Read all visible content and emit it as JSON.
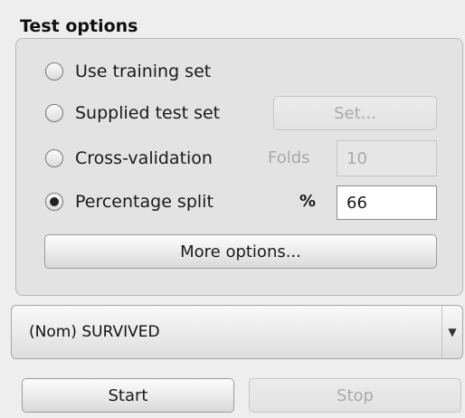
{
  "test_options": {
    "title": "Test options",
    "use_training_set": {
      "label": "Use training set",
      "selected": false
    },
    "supplied_test_set": {
      "label": "Supplied test set",
      "selected": false,
      "set_button": "Set..."
    },
    "cross_validation": {
      "label": "Cross-validation",
      "selected": false,
      "folds_label": "Folds",
      "folds_value": "10"
    },
    "percentage_split": {
      "label": "Percentage split",
      "selected": true,
      "percent_label": "%",
      "percent_value": "66"
    },
    "more_options_button": "More options..."
  },
  "class_select": {
    "value": "(Nom) SURVIVED",
    "arrow_icon": "triangle-down"
  },
  "actions": {
    "start_label": "Start",
    "stop_label": "Stop"
  }
}
